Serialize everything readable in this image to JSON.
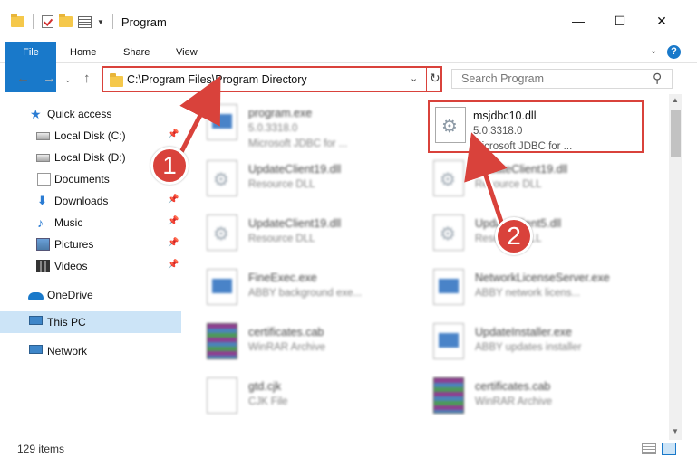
{
  "window": {
    "title": "Program",
    "minimize": "—",
    "maximize": "☐",
    "close": "✕"
  },
  "ribbon": {
    "tabs": [
      "File",
      "Home",
      "Share",
      "View"
    ],
    "help": "?"
  },
  "address": {
    "path": "C:\\Program Files\\Program Directory",
    "search_placeholder": "Search Program"
  },
  "sidebar": {
    "items": [
      {
        "label": "Quick access",
        "icon": "star-icon",
        "pinned": false
      },
      {
        "label": "Local Disk (C:)",
        "icon": "drive-icon",
        "pinned": true
      },
      {
        "label": "Local Disk (D:)",
        "icon": "drive-icon",
        "pinned": false
      },
      {
        "label": "Documents",
        "icon": "documents-icon",
        "pinned": false
      },
      {
        "label": "Downloads",
        "icon": "download-icon",
        "pinned": true
      },
      {
        "label": "Music",
        "icon": "music-icon",
        "pinned": true
      },
      {
        "label": "Pictures",
        "icon": "pictures-icon",
        "pinned": true
      },
      {
        "label": "Videos",
        "icon": "videos-icon",
        "pinned": true
      },
      {
        "label": "OneDrive",
        "icon": "onedrive-icon",
        "pinned": false
      },
      {
        "label": "This PC",
        "icon": "computer-icon",
        "pinned": false,
        "selected": true
      },
      {
        "label": "Network",
        "icon": "network-icon",
        "pinned": false
      }
    ]
  },
  "files": [
    {
      "name": "program.exe",
      "line2": "5.0.3318.0",
      "line3": "Microsoft JDBC for ...",
      "kind": "exe"
    },
    {
      "name": "msjdbc10.dll",
      "line2": "5.0.3318.0",
      "line3": "Microsoft JDBC for ...",
      "kind": "dll",
      "highlighted": true
    },
    {
      "name": "UpdateClient19.dll",
      "line2": "Resource DLL",
      "line3": "",
      "kind": "dll"
    },
    {
      "name": "UpdateClient19.dll",
      "line2": "Resource DLL",
      "line3": "",
      "kind": "dll"
    },
    {
      "name": "UpdateClient19.dll",
      "line2": "Resource DLL",
      "line3": "",
      "kind": "dll"
    },
    {
      "name": "UpdateClient5.dll",
      "line2": "Resource DLL",
      "line3": "",
      "kind": "dll"
    },
    {
      "name": "FineExec.exe",
      "line2": "ABBY background exe...",
      "line3": "",
      "kind": "exe"
    },
    {
      "name": "NetworkLicenseServer.exe",
      "line2": "ABBY network licens...",
      "line3": "",
      "kind": "exe"
    },
    {
      "name": "certificates.cab",
      "line2": "WinRAR Archive",
      "line3": "",
      "kind": "cab"
    },
    {
      "name": "UpdateInstaller.exe",
      "line2": "ABBY updates installer",
      "line3": "",
      "kind": "exe"
    },
    {
      "name": "gtd.cjk",
      "line2": "CJK File",
      "line3": "",
      "kind": "blank"
    },
    {
      "name": "certificates.cab",
      "line2": "WinRAR Archive",
      "line3": "",
      "kind": "cab"
    }
  ],
  "status": {
    "item_count": "129 items"
  },
  "callouts": [
    "1",
    "2"
  ],
  "colors": {
    "accent": "#1979ca",
    "highlight": "#d9423b",
    "selected": "#cce4f7"
  }
}
